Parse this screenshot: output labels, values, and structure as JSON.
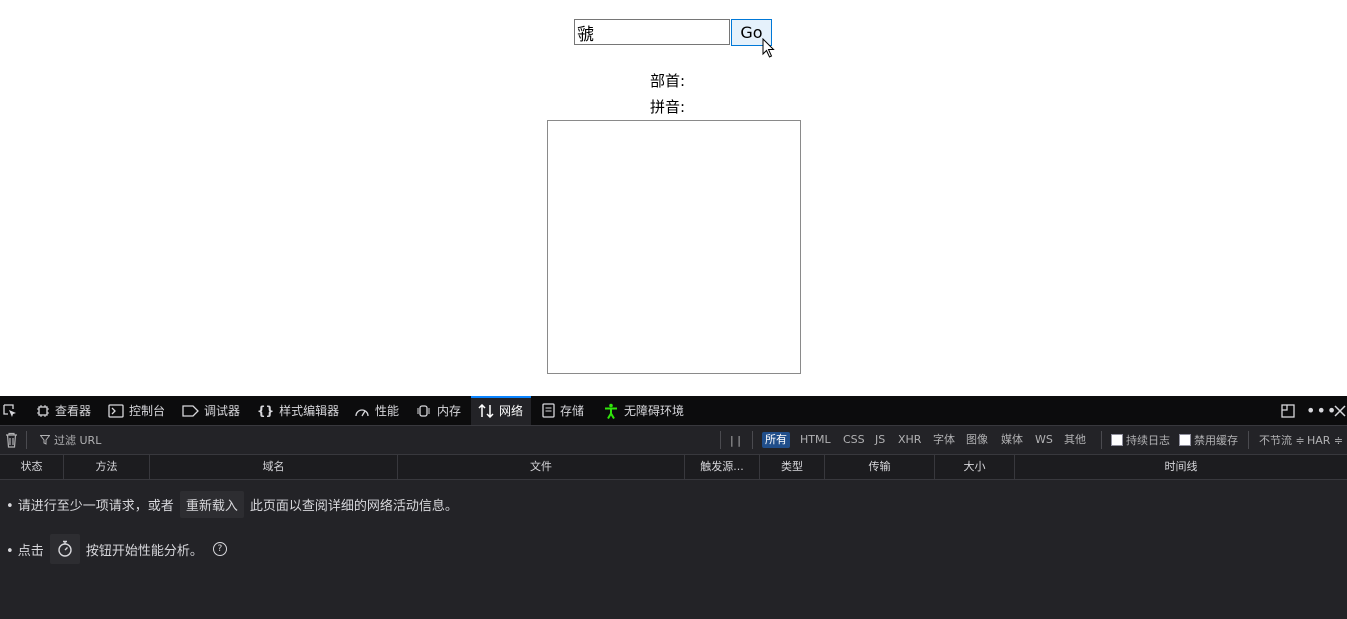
{
  "page": {
    "search_value": "虢",
    "go_label": "Go",
    "radical_label": "部首:",
    "pinyin_label": "拼音:"
  },
  "devtools": {
    "tabs": [
      {
        "label": "查看器",
        "icon": "inspector-icon"
      },
      {
        "label": "控制台",
        "icon": "console-icon"
      },
      {
        "label": "调试器",
        "icon": "debugger-icon"
      },
      {
        "label": "样式编辑器",
        "icon": "style-editor-icon"
      },
      {
        "label": "性能",
        "icon": "performance-icon"
      },
      {
        "label": "内存",
        "icon": "memory-icon"
      },
      {
        "label": "网络",
        "icon": "network-icon"
      },
      {
        "label": "存储",
        "icon": "storage-icon"
      },
      {
        "label": "无障碍环境",
        "icon": "accessibility-icon"
      }
    ],
    "active_tab": "网络",
    "toolbar": {
      "filter_placeholder": "过滤 URL",
      "pause_label": "| |",
      "filters": [
        "所有",
        "HTML",
        "CSS",
        "JS",
        "XHR",
        "字体",
        "图像",
        "媒体",
        "WS",
        "其他"
      ],
      "selected_filter": "所有",
      "persist_logs": "持续日志",
      "disable_cache": "禁用缓存",
      "throttle": "不节流 ≑",
      "har": "HAR ≑"
    },
    "columns": [
      "状态",
      "方法",
      "域名",
      "文件",
      "触发源...",
      "类型",
      "传输",
      "大小",
      "时间线"
    ],
    "empty": {
      "line1_prefix": "• 请进行至少一项请求，或者",
      "reload_button": "重新载入",
      "line1_suffix": "此页面以查阅详细的网络活动信息。",
      "line2_prefix": "• 点击",
      "line2_suffix": "按钮开始性能分析。",
      "help_icon": "?"
    },
    "colors": {
      "accent": "#0a84ff",
      "selected_filter_bg": "#204e8a",
      "panel_bg": "#232327",
      "tabbar_bg": "#0c0c0d",
      "accessibility_icon": "#30e60b"
    }
  }
}
